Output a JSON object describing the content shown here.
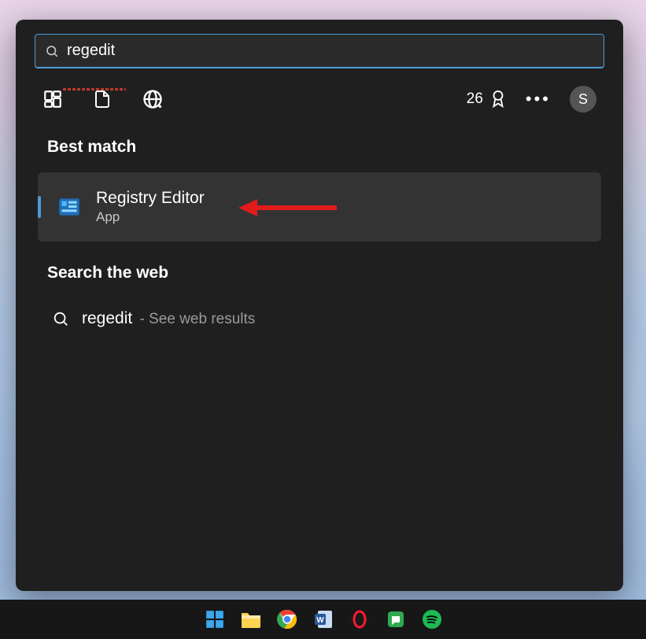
{
  "search": {
    "query": "regedit"
  },
  "toolbar": {
    "points": "26",
    "avatar_initial": "S"
  },
  "sections": {
    "best_match_label": "Best match",
    "web_label": "Search the web"
  },
  "best_match": {
    "title": "Registry Editor",
    "subtitle": "App"
  },
  "web_result": {
    "term": "regedit",
    "suffix": " - See web results"
  },
  "annotation": {
    "arrow_color": "#e21b1b"
  }
}
